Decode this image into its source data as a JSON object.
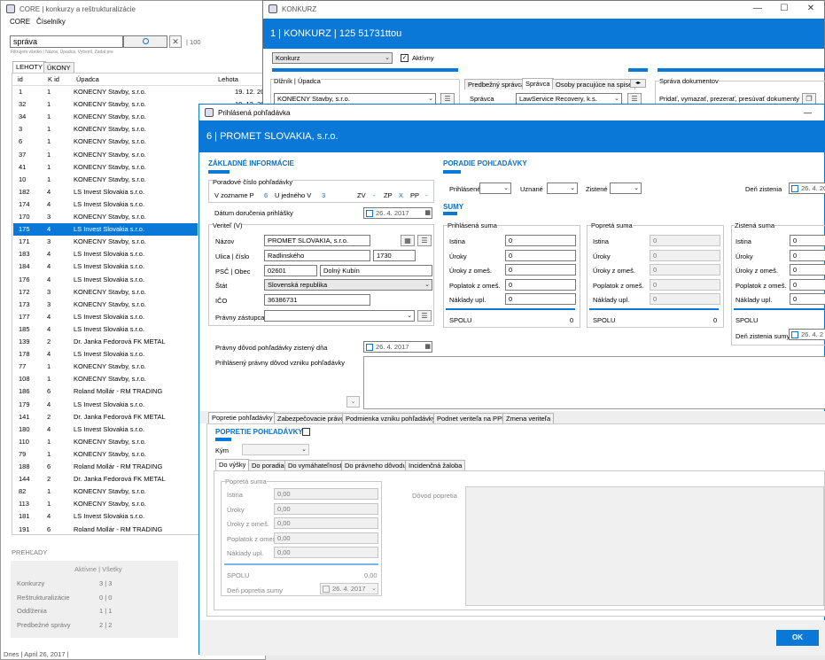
{
  "main_window": {
    "title": "CORE | konkurzy a reštrukturalizácie",
    "menu": [
      "CORE",
      "Číselníky"
    ],
    "search": {
      "value": "správa",
      "hint": "Filtrujem všetko | Názov, Úpadca, Vytvoril, Zadal pre",
      "count": "| 100"
    },
    "tabs": [
      "LEHOTY",
      "ÚKONY"
    ],
    "columns": [
      "id",
      "K id",
      "Úpadca",
      "Lehota"
    ],
    "rows": [
      {
        "id": "1",
        "kid": "1",
        "upadca": "KONECNY Stavby, s.r.o.",
        "lehota": "19. 12. 20"
      },
      {
        "id": "32",
        "kid": "1",
        "upadca": "KONECNY Stavby, s.r.o.",
        "lehota": "19. 12. 20"
      },
      {
        "id": "34",
        "kid": "1",
        "upadca": "KONECNY Stavby, s.r.o.",
        "lehota": ""
      },
      {
        "id": "3",
        "kid": "1",
        "upadca": "KONECNY Stavby, s.r.o.",
        "lehota": ""
      },
      {
        "id": "6",
        "kid": "1",
        "upadca": "KONECNY Stavby, s.r.o.",
        "lehota": ""
      },
      {
        "id": "37",
        "kid": "1",
        "upadca": "KONECNY Stavby, s.r.o.",
        "lehota": ""
      },
      {
        "id": "41",
        "kid": "1",
        "upadca": "KONECNY Stavby, s.r.o.",
        "lehota": ""
      },
      {
        "id": "10",
        "kid": "1",
        "upadca": "KONECNY Stavby, s.r.o.",
        "lehota": ""
      },
      {
        "id": "182",
        "kid": "4",
        "upadca": "LS Invest Slovakia s.r.o.",
        "lehota": ""
      },
      {
        "id": "174",
        "kid": "4",
        "upadca": "LS Invest Slovakia s.r.o.",
        "lehota": ""
      },
      {
        "id": "170",
        "kid": "3",
        "upadca": "KONECNY Stavby, s.r.o.",
        "lehota": ""
      },
      {
        "id": "175",
        "kid": "4",
        "upadca": "LS Invest Slovakia s.r.o.",
        "lehota": ""
      },
      {
        "id": "171",
        "kid": "3",
        "upadca": "KONECNY Stavby, s.r.o.",
        "lehota": ""
      },
      {
        "id": "183",
        "kid": "4",
        "upadca": "LS Invest Slovakia s.r.o.",
        "lehota": ""
      },
      {
        "id": "184",
        "kid": "4",
        "upadca": "LS Invest Slovakia s.r.o.",
        "lehota": ""
      },
      {
        "id": "176",
        "kid": "4",
        "upadca": "LS Invest Slovakia s.r.o.",
        "lehota": ""
      },
      {
        "id": "172",
        "kid": "3",
        "upadca": "KONECNY Stavby, s.r.o.",
        "lehota": ""
      },
      {
        "id": "173",
        "kid": "3",
        "upadca": "KONECNY Stavby, s.r.o.",
        "lehota": ""
      },
      {
        "id": "177",
        "kid": "4",
        "upadca": "LS Invest Slovakia s.r.o.",
        "lehota": ""
      },
      {
        "id": "185",
        "kid": "4",
        "upadca": "LS Invest Slovakia s.r.o.",
        "lehota": ""
      },
      {
        "id": "139",
        "kid": "2",
        "upadca": "Dr. Janka Fedorová FK METAL",
        "lehota": ""
      },
      {
        "id": "178",
        "kid": "4",
        "upadca": "LS Invest Slovakia s.r.o.",
        "lehota": ""
      },
      {
        "id": "77",
        "kid": "1",
        "upadca": "KONECNY Stavby, s.r.o.",
        "lehota": ""
      },
      {
        "id": "108",
        "kid": "1",
        "upadca": "KONECNY Stavby, s.r.o.",
        "lehota": ""
      },
      {
        "id": "186",
        "kid": "6",
        "upadca": "Roland Mollár - RM TRADING",
        "lehota": ""
      },
      {
        "id": "179",
        "kid": "4",
        "upadca": "LS Invest Slovakia s.r.o.",
        "lehota": ""
      },
      {
        "id": "141",
        "kid": "2",
        "upadca": "Dr. Janka Fedorová FK METAL",
        "lehota": ""
      },
      {
        "id": "180",
        "kid": "4",
        "upadca": "LS Invest Slovakia s.r.o.",
        "lehota": ""
      },
      {
        "id": "110",
        "kid": "1",
        "upadca": "KONECNY Stavby, s.r.o.",
        "lehota": ""
      },
      {
        "id": "79",
        "kid": "1",
        "upadca": "KONECNY Stavby, s.r.o.",
        "lehota": ""
      },
      {
        "id": "188",
        "kid": "6",
        "upadca": "Roland Mollár - RM TRADING",
        "lehota": ""
      },
      {
        "id": "144",
        "kid": "2",
        "upadca": "Dr. Janka Fedorová FK METAL",
        "lehota": ""
      },
      {
        "id": "82",
        "kid": "1",
        "upadca": "KONECNY Stavby, s.r.o.",
        "lehota": ""
      },
      {
        "id": "113",
        "kid": "1",
        "upadca": "KONECNY Stavby, s.r.o.",
        "lehota": ""
      },
      {
        "id": "181",
        "kid": "4",
        "upadca": "LS Invest Slovakia s.r.o.",
        "lehota": ""
      },
      {
        "id": "191",
        "kid": "6",
        "upadca": "Roland Mollár - RM TRADING",
        "lehota": ""
      }
    ],
    "selected_index": 11,
    "overview": {
      "title": "PREHĽADY",
      "header": "Aktívne | Všetky",
      "items": [
        {
          "label": "Konkurzy",
          "value": "3 | 3"
        },
        {
          "label": "Reštrukturalizácie",
          "value": "0 | 0"
        },
        {
          "label": "Oddlženia",
          "value": "1 | 1"
        },
        {
          "label": "Predbežné správy",
          "value": "2 | 2"
        }
      ]
    },
    "status": "Dnes | April 26, 2017 |"
  },
  "konkurz_window": {
    "title": "KONKURZ",
    "header": "1 | KONKURZ | 125 51731ttou",
    "type_combo": "Konkurz",
    "active_label": "Aktívny",
    "dlznik_label": "Dlžník | Úpadca",
    "dlznik_value": "KONECNY Stavby, s.r.o.",
    "tabs": [
      "Predbežný správca",
      "Správca",
      "Osoby pracujúce na spise"
    ],
    "spravca_label": "Správca",
    "spravca_value": "LawService Recovery, k.s.",
    "docs_title": "Správa dokumentov",
    "docs_text": "Pridať, vymazať, prezerať, presúvať dokumenty"
  },
  "dialog": {
    "title": "Prihlásená pohľadávka",
    "header": "6 | PROMET SLOVAKIA, s.r.o.",
    "basic": {
      "title": "ZÁKLADNÉ INFORMÁCIE",
      "poradove_label": "Poradové číslo pohľadávky",
      "v_zozname_label": "V zozname P",
      "v_zozname_value": "6",
      "u_jedneho_label": "U jedného V",
      "u_jedneho_value": "3",
      "zv_label": "ZV",
      "zv_value": "-",
      "zp_label": "ZP",
      "zp_value": "X",
      "pp_label": "PP",
      "pp_value": "-",
      "datum_label": "Dátum doručenia prihlášky",
      "datum_value": "26.  4. 2017"
    },
    "creditor": {
      "title": "Veriteľ (V)",
      "nazov_label": "Názov",
      "nazov_value": "PROMET SLOVAKIA, s.r.o.",
      "ulica_label": "Ulica | číslo",
      "ulica_value": "Radlinského",
      "cislo_value": "1730",
      "psc_label": "PSČ | Obec",
      "psc_value": "02601",
      "obec_value": "Dolný Kubín",
      "stat_label": "Štát",
      "stat_value": "Slovenská republika",
      "ico_label": "IČO",
      "ico_value": "36386731",
      "zastupca_label": "Právny zástupca",
      "zastupca_value": ""
    },
    "order": {
      "title": "PORADIE POHĽADÁVKY",
      "prihlasene_label": "Prihlásené",
      "uznane_label": "Uznané",
      "zistene_label": "Zistené",
      "den_label": "Deň zistenia",
      "den_value": "26.  4. 20"
    },
    "sums": {
      "title": "SUMY",
      "prihlasena": {
        "title": "Prihlásená suma",
        "rows": [
          {
            "label": "Istina",
            "value": "0"
          },
          {
            "label": "Úroky",
            "value": "0"
          },
          {
            "label": "Úroky z omeš.",
            "value": "0"
          },
          {
            "label": "Poplatok z omeš.",
            "value": "0"
          },
          {
            "label": "Náklady upl.",
            "value": "0"
          }
        ],
        "spolu_label": "SPOLU",
        "spolu_value": "0"
      },
      "poprieta": {
        "title": "Popretá suma",
        "rows": [
          {
            "label": "Istina",
            "value": "0"
          },
          {
            "label": "Úroky",
            "value": "0"
          },
          {
            "label": "Úroky z omeš.",
            "value": "0"
          },
          {
            "label": "Poplatok z omeš.",
            "value": "0"
          },
          {
            "label": "Náklady upl.",
            "value": "0"
          }
        ],
        "spolu_label": "SPOLU",
        "spolu_value": "0"
      },
      "zistena": {
        "title": "Zistená suma",
        "rows": [
          {
            "label": "Istina",
            "value": "0"
          },
          {
            "label": "Úroky",
            "value": "0"
          },
          {
            "label": "Úroky z omeš.",
            "value": "0"
          },
          {
            "label": "Poplatok z omeš.",
            "value": "0"
          },
          {
            "label": "Náklady upl.",
            "value": "0"
          }
        ],
        "spolu_label": "SPOLU",
        "den_label": "Deň zistenia sumy",
        "den_value": "26.  4. 2"
      }
    },
    "legal": {
      "dovod_label": "Právny dôvod pohľadávky zistený dňa",
      "dovod_date": "26.  4. 2017",
      "prihlaseny_label": "Prihlásený právny dôvod vzniku pohľadávky"
    },
    "tabs": [
      "Popretie pohľadávky",
      "Zabezpečovacie právo",
      "Podmienka vzniku pohľadávky",
      "Podnet veriteľa na PPP",
      "Zmena veriteľa"
    ],
    "popretie": {
      "title": "POPRETIE POHĽADÁVKY",
      "kym_label": "Kým",
      "subtabs": [
        "Do výšky",
        "Do poradia",
        "Do vymáhateľnosti",
        "Do právneho dôvodu",
        "Incidenčná žaloba"
      ],
      "group_title": "Popretá suma",
      "rows": [
        {
          "label": "Istina",
          "value": "0,00"
        },
        {
          "label": "Úroky",
          "value": "0,00"
        },
        {
          "label": "Úroky z omeš.",
          "value": "0,00"
        },
        {
          "label": "Poplatok z omeš.",
          "value": "0,00"
        },
        {
          "label": "Náklady upl.",
          "value": "0,00"
        }
      ],
      "spolu_label": "SPOLU",
      "spolu_value": "0,00",
      "den_label": "Deň popretia sumy",
      "den_value": "26.  4. 2017",
      "dovod_label": "Dôvod popretia"
    },
    "ok_label": "OK"
  }
}
